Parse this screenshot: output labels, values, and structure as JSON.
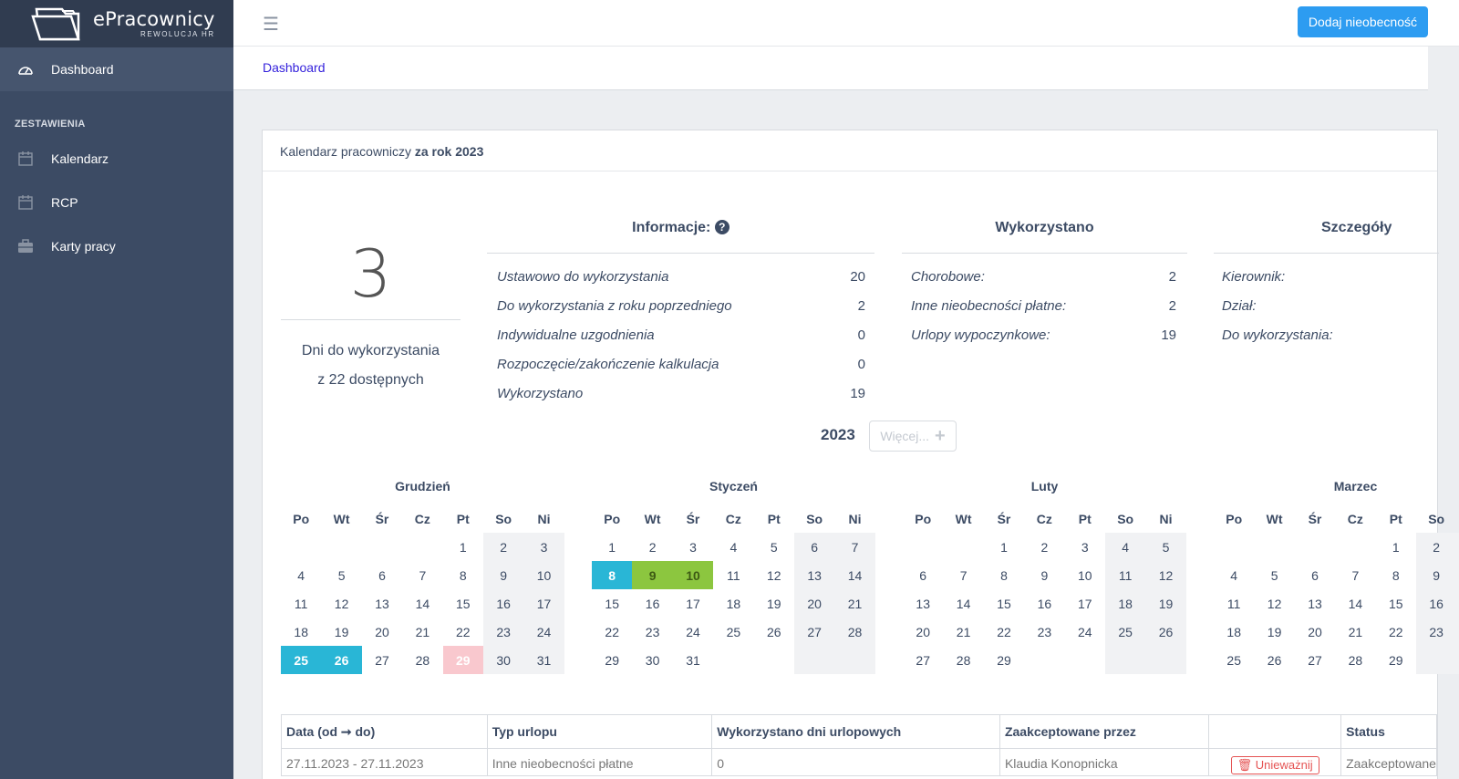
{
  "app": {
    "name": "ePracownicy",
    "tagline": "REWOLUCJA HR"
  },
  "sidebar": {
    "dashboard": "Dashboard",
    "section_title": "ZESTAWIENIA",
    "items": [
      {
        "label": "Kalendarz",
        "icon": "calendar-icon"
      },
      {
        "label": "RCP",
        "icon": "calendar-icon"
      },
      {
        "label": "Karty pracy",
        "icon": "briefcase-icon"
      }
    ]
  },
  "header": {
    "menu_icon": "☰",
    "add_button": "Dodaj nieobecność",
    "accent": "#2d9cf1"
  },
  "breadcrumb": "Dashboard",
  "card": {
    "title_prefix": "Kalendarz pracowniczy",
    "title_bold": "za rok 2023"
  },
  "summary": {
    "days_left": "3",
    "line1": "Dni do wykorzystania",
    "line2": "z 22 dostępnych"
  },
  "info": {
    "heading": "Informacje:",
    "rows": [
      {
        "label": "Ustawowo do wykorzystania",
        "value": "20"
      },
      {
        "label": "Do wykorzystania z roku poprzedniego",
        "value": "2"
      },
      {
        "label": "Indywidualne uzgodnienia",
        "value": "0"
      },
      {
        "label": "Rozpoczęcie/zakończenie kalkulacja",
        "value": "0"
      },
      {
        "label": "Wykorzystano",
        "value": "19"
      }
    ]
  },
  "used": {
    "heading": "Wykorzystano",
    "rows": [
      {
        "label": "Chorobowe:",
        "value": "2"
      },
      {
        "label": "Inne nieobecności płatne:",
        "value": "2"
      },
      {
        "label": "Urlopy wypoczynkowe:",
        "value": "19"
      }
    ]
  },
  "details": {
    "heading": "Szczegóły",
    "rows": [
      {
        "label": "Kierownik:"
      },
      {
        "label": "Dział:"
      },
      {
        "label": "Do wykorzystania:"
      }
    ]
  },
  "calendar_nav": {
    "year": "2023",
    "more": "Więcej..."
  },
  "weekdays": [
    "Po",
    "Wt",
    "Śr",
    "Cz",
    "Pt",
    "So",
    "Ni"
  ],
  "months": [
    {
      "name": "Grudzień",
      "offset": 4,
      "days": 31,
      "colorize": {
        "25": "blue",
        "26": "blue",
        "29": "pink"
      }
    },
    {
      "name": "Styczeń",
      "offset": 0,
      "days": 31,
      "colorize": {
        "8": "blue",
        "9": "green",
        "10": "green"
      }
    },
    {
      "name": "Luty",
      "offset": 2,
      "days": 29,
      "colorize": {}
    },
    {
      "name": "Marzec",
      "offset": 4,
      "days": 29,
      "colorize": {}
    }
  ],
  "table": {
    "headers": [
      "Data (od ➞ do)",
      "Typ urlopu",
      "Wykorzystano dni urlopowych",
      "Zaakceptowane przez",
      "",
      "Status"
    ],
    "row": [
      "27.11.2023 - 27.11.2023",
      "Inne nieobecności płatne",
      "0",
      "Klaudia Konopnicka",
      "Unieważnij",
      "Zaakceptowane"
    ]
  }
}
